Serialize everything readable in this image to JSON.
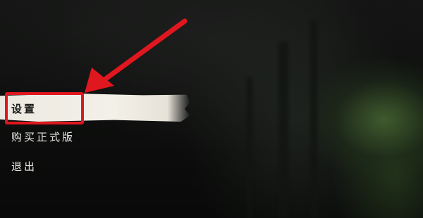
{
  "menu": {
    "items": [
      {
        "label": "设置",
        "selected": true
      },
      {
        "label": "购买正式版",
        "selected": false
      },
      {
        "label": "退出",
        "selected": false
      }
    ]
  },
  "annotation": {
    "color": "#e0171f",
    "shapes": [
      "highlight-box",
      "pointer-arrow"
    ]
  }
}
